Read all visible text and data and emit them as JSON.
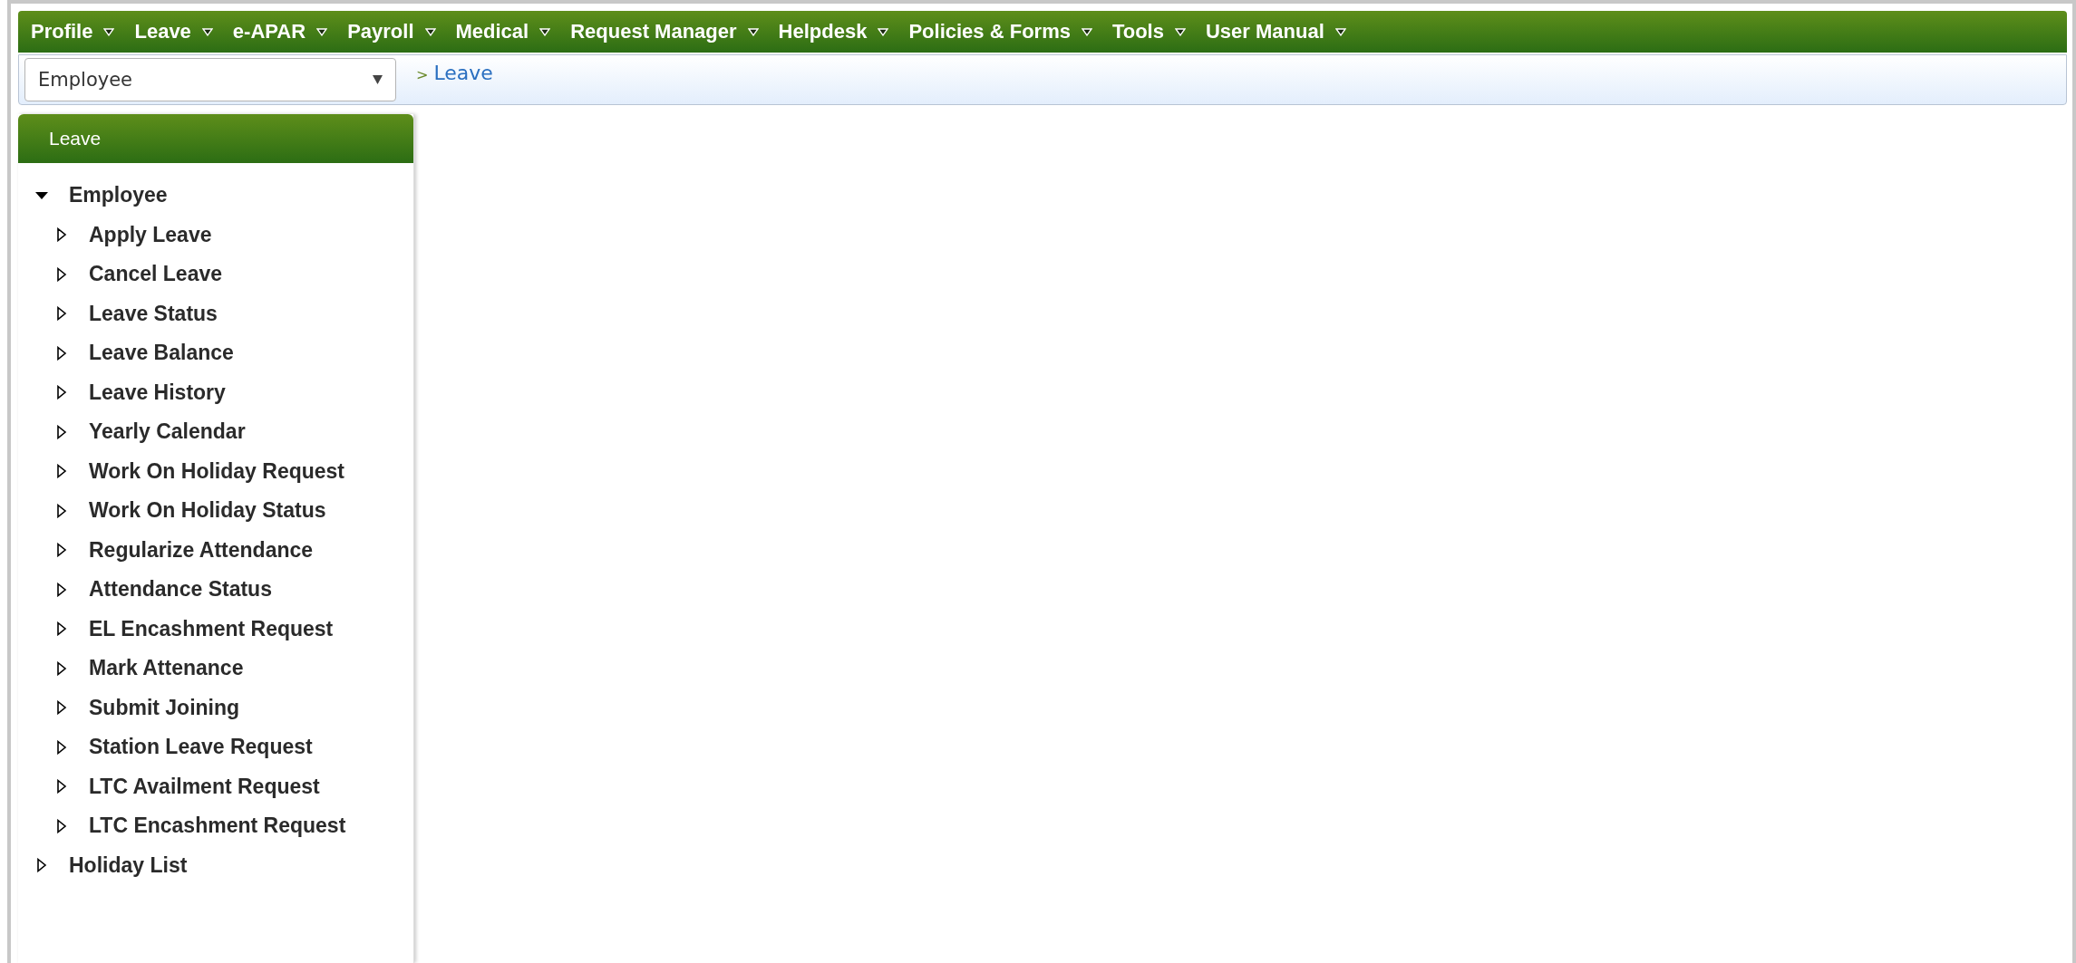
{
  "menu": [
    {
      "label": "Profile"
    },
    {
      "label": "Leave"
    },
    {
      "label": "e-APAR"
    },
    {
      "label": "Payroll"
    },
    {
      "label": "Medical"
    },
    {
      "label": "Request Manager"
    },
    {
      "label": "Helpdesk"
    },
    {
      "label": "Policies & Forms"
    },
    {
      "label": "Tools"
    },
    {
      "label": "User Manual"
    }
  ],
  "role_select": {
    "value": "Employee"
  },
  "breadcrumb": {
    "separator": ">",
    "items": [
      "Leave"
    ]
  },
  "sidebar": {
    "title": "Leave",
    "tree": [
      {
        "label": "Employee",
        "expanded": true,
        "children": [
          {
            "label": "Apply Leave",
            "expanded": false
          },
          {
            "label": "Cancel Leave",
            "expanded": false
          },
          {
            "label": "Leave Status",
            "expanded": false
          },
          {
            "label": "Leave Balance",
            "expanded": false
          },
          {
            "label": "Leave History",
            "expanded": false
          },
          {
            "label": "Yearly Calendar",
            "expanded": false
          },
          {
            "label": "Work On Holiday Request",
            "expanded": false
          },
          {
            "label": "Work On Holiday Status",
            "expanded": false
          },
          {
            "label": "Regularize Attendance",
            "expanded": false
          },
          {
            "label": "Attendance Status",
            "expanded": false
          },
          {
            "label": "EL Encashment Request",
            "expanded": false
          },
          {
            "label": "Mark Attenance",
            "expanded": false
          },
          {
            "label": "Submit Joining",
            "expanded": false
          },
          {
            "label": "Station Leave Request",
            "expanded": false
          },
          {
            "label": "LTC Availment Request",
            "expanded": false
          },
          {
            "label": "LTC Encashment Request",
            "expanded": false
          }
        ]
      },
      {
        "label": "Holiday List",
        "expanded": false
      }
    ]
  }
}
